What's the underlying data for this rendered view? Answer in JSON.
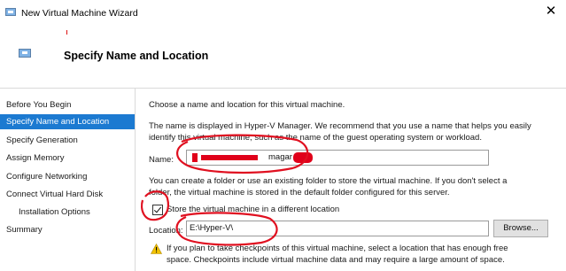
{
  "window": {
    "title": "New Virtual Machine Wizard",
    "close_glyph": "✕",
    "icon": "virtual-machine-icon"
  },
  "header": {
    "title": "Specify Name and Location",
    "icon": "virtual-machine-icon"
  },
  "nav": {
    "items": [
      {
        "label": "Before You Begin",
        "active": false
      },
      {
        "label": "Specify Name and Location",
        "active": true
      },
      {
        "label": "Specify Generation",
        "active": false
      },
      {
        "label": "Assign Memory",
        "active": false
      },
      {
        "label": "Configure Networking",
        "active": false
      },
      {
        "label": "Connect Virtual Hard Disk",
        "active": false
      },
      {
        "label": "Installation Options",
        "active": false
      },
      {
        "label": "Summary",
        "active": false
      }
    ]
  },
  "content": {
    "intro": "Choose a name and location for this virtual machine.",
    "name_help_line1": "The name is displayed in Hyper-V Manager. We recommend that you use a name that helps you easily",
    "name_help_line2": "identify this virtual machine, such as the name of the guest operating system or workload.",
    "name_label": "Name:",
    "name_value_suffix": "magar",
    "folder_help_line1": "You can create a folder or use an existing folder to store the virtual machine. If you don't select a",
    "folder_help_line2": "folder, the virtual machine is stored in the default folder configured for this server.",
    "store_checkbox_label": "Store the virtual machine in a different location",
    "store_checkbox_checked": true,
    "location_label": "Location:",
    "location_value": "E:\\Hyper-V\\",
    "browse_label": "Browse...",
    "warning_line1": "If you plan to take checkpoints of this virtual machine, select a location that has enough free",
    "warning_line2": "space. Checkpoints include virtual machine data and may require a large amount of space."
  },
  "colors": {
    "accent": "#1c7ad1",
    "redaction": "#e0001a",
    "annotation": "#e01020",
    "warning": "#f2c200"
  }
}
